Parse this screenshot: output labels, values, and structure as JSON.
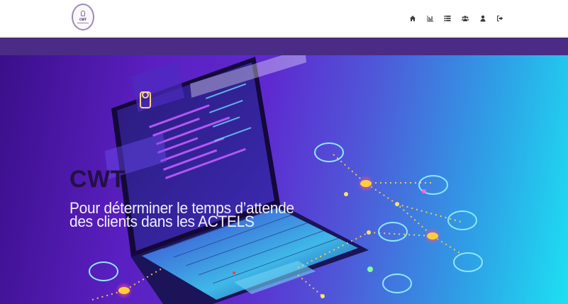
{
  "app": {
    "logo_text": "CWT"
  },
  "nav": {
    "icons": [
      "home-icon",
      "bar-chart-icon",
      "list-icon",
      "users-icon",
      "user-icon",
      "sign-out-icon"
    ]
  },
  "hero": {
    "title": "CWT",
    "subtitle": "Pour déterminer le temps d’attende des clients dans les ACTELS"
  },
  "colors": {
    "banner": "#4a2c86",
    "hero_start": "#3a0f8a",
    "hero_end": "#1de0f2"
  }
}
